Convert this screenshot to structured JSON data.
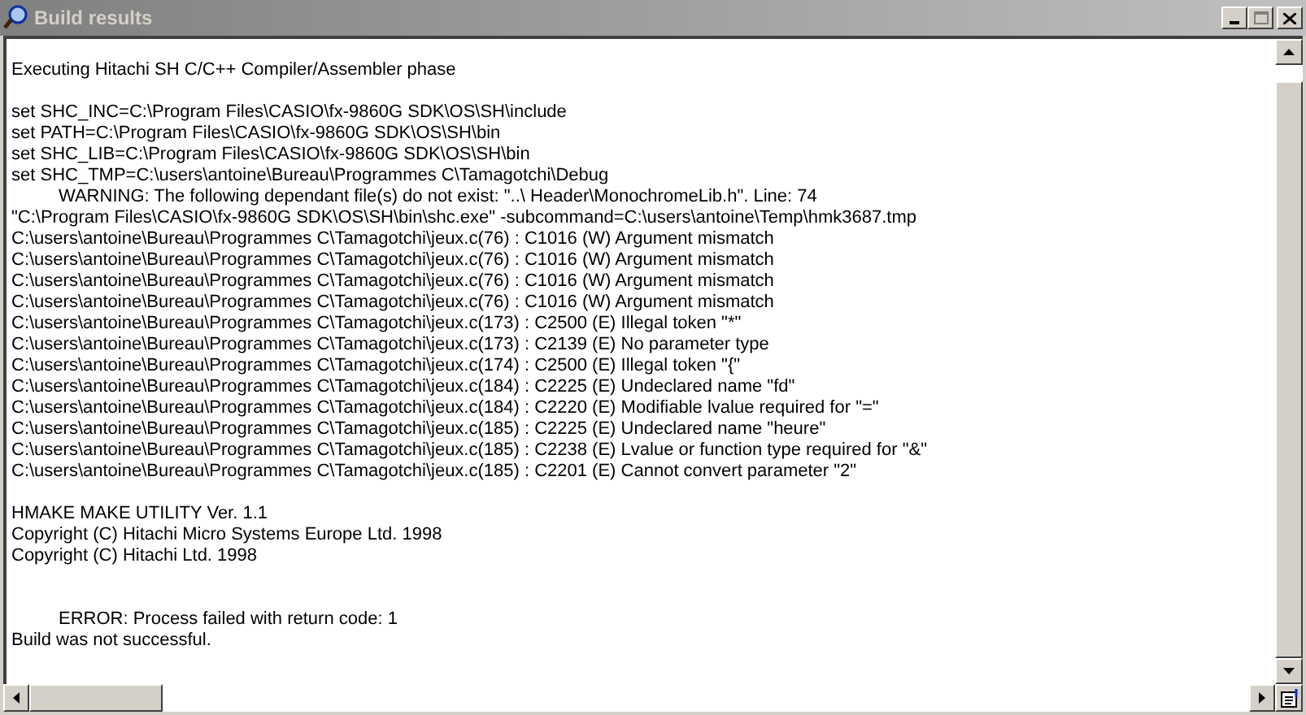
{
  "window": {
    "title": "Build results"
  },
  "lines": [
    {
      "kind": "plain",
      "text": "Executing Hitachi SH C/C++ Compiler/Assembler phase"
    },
    {
      "kind": "blank"
    },
    {
      "kind": "plain",
      "text": "set SHC_INC=C:\\Program Files\\CASIO\\fx-9860G SDK\\OS\\SH\\include"
    },
    {
      "kind": "plain",
      "text": "set PATH=C:\\Program Files\\CASIO\\fx-9860G SDK\\OS\\SH\\bin"
    },
    {
      "kind": "plain",
      "text": "set SHC_LIB=C:\\Program Files\\CASIO\\fx-9860G SDK\\OS\\SH\\bin"
    },
    {
      "kind": "plain",
      "text": "set SHC_TMP=C:\\users\\antoine\\Bureau\\Programmes C\\Tamagotchi\\Debug"
    },
    {
      "kind": "indented",
      "text": "WARNING: The following dependant file(s) do not exist: \"..\\ Header\\MonochromeLib.h\". Line: 74"
    },
    {
      "kind": "plain",
      "text": "\"C:\\Program Files\\CASIO\\fx-9860G SDK\\OS\\SH\\bin\\shc.exe\" -subcommand=C:\\users\\antoine\\Temp\\hmk3687.tmp"
    },
    {
      "kind": "plain",
      "text": "C:\\users\\antoine\\Bureau\\Programmes C\\Tamagotchi\\jeux.c(76) : C1016 (W) Argument mismatch"
    },
    {
      "kind": "plain",
      "text": "C:\\users\\antoine\\Bureau\\Programmes C\\Tamagotchi\\jeux.c(76) : C1016 (W) Argument mismatch"
    },
    {
      "kind": "plain",
      "text": "C:\\users\\antoine\\Bureau\\Programmes C\\Tamagotchi\\jeux.c(76) : C1016 (W) Argument mismatch"
    },
    {
      "kind": "plain",
      "text": "C:\\users\\antoine\\Bureau\\Programmes C\\Tamagotchi\\jeux.c(76) : C1016 (W) Argument mismatch"
    },
    {
      "kind": "plain",
      "text": "C:\\users\\antoine\\Bureau\\Programmes C\\Tamagotchi\\jeux.c(173) : C2500 (E) Illegal token \"*\""
    },
    {
      "kind": "plain",
      "text": "C:\\users\\antoine\\Bureau\\Programmes C\\Tamagotchi\\jeux.c(173) : C2139 (E) No parameter type"
    },
    {
      "kind": "plain",
      "text": "C:\\users\\antoine\\Bureau\\Programmes C\\Tamagotchi\\jeux.c(174) : C2500 (E) Illegal token \"{\""
    },
    {
      "kind": "plain",
      "text": "C:\\users\\antoine\\Bureau\\Programmes C\\Tamagotchi\\jeux.c(184) : C2225 (E) Undeclared name \"fd\""
    },
    {
      "kind": "plain",
      "text": "C:\\users\\antoine\\Bureau\\Programmes C\\Tamagotchi\\jeux.c(184) : C2220 (E) Modifiable lvalue required for \"=\""
    },
    {
      "kind": "plain",
      "text": "C:\\users\\antoine\\Bureau\\Programmes C\\Tamagotchi\\jeux.c(185) : C2225 (E) Undeclared name \"heure\""
    },
    {
      "kind": "plain",
      "text": "C:\\users\\antoine\\Bureau\\Programmes C\\Tamagotchi\\jeux.c(185) : C2238 (E) Lvalue or function type required for \"&\""
    },
    {
      "kind": "plain",
      "text": "C:\\users\\antoine\\Bureau\\Programmes C\\Tamagotchi\\jeux.c(185) : C2201 (E) Cannot convert parameter \"2\""
    },
    {
      "kind": "blank"
    },
    {
      "kind": "plain",
      "text": "HMAKE MAKE UTILITY Ver. 1.1"
    },
    {
      "kind": "plain",
      "text": "Copyright (C) Hitachi Micro Systems Europe Ltd. 1998"
    },
    {
      "kind": "plain",
      "text": "Copyright (C) Hitachi Ltd. 1998"
    },
    {
      "kind": "blank"
    },
    {
      "kind": "blank"
    },
    {
      "kind": "indented",
      "text": "ERROR: Process failed with return code: 1"
    },
    {
      "kind": "plain",
      "text": "Build was not successful."
    }
  ]
}
